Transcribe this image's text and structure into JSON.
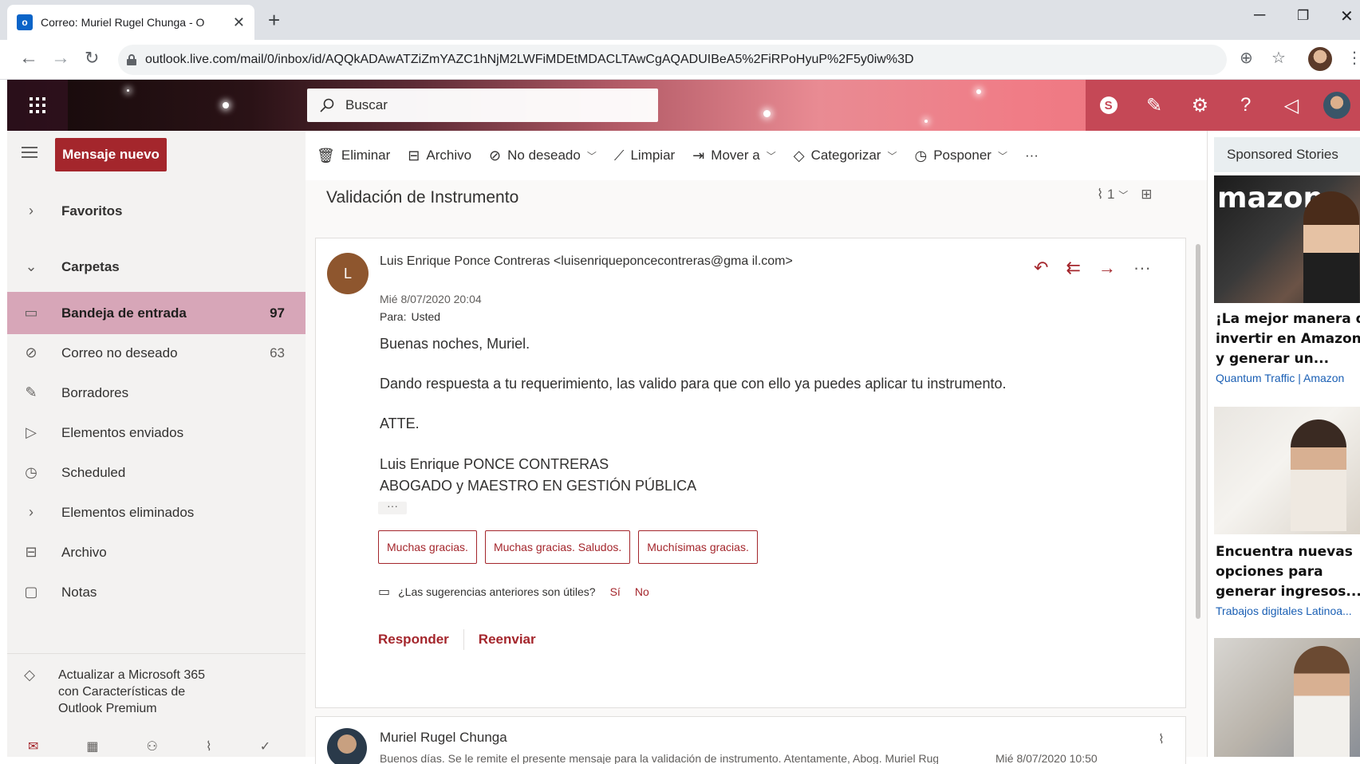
{
  "browser": {
    "tab_title": "Correo: Muriel Rugel Chunga - O",
    "url": "outlook.live.com/mail/0/inbox/id/AQQkADAwATZiZmYAZC1hNjM2LWFiMDEtMDACLTAwCgAQADUIBeA5%2FiRPoHyuP%2F5y0iw%3D"
  },
  "header": {
    "search_placeholder": "Buscar"
  },
  "nav": {
    "new_message": "Mensaje nuevo",
    "favorites": "Favoritos",
    "folders": "Carpetas",
    "items": [
      {
        "label": "Bandeja de entrada",
        "count": "97",
        "icon": "inbox-icon"
      },
      {
        "label": "Correo no deseado",
        "count": "63",
        "icon": "blocked-icon"
      },
      {
        "label": "Borradores",
        "count": "",
        "icon": "pencil-icon"
      },
      {
        "label": "Elementos enviados",
        "count": "",
        "icon": "send-icon"
      },
      {
        "label": "Scheduled",
        "count": "",
        "icon": "clock-icon"
      },
      {
        "label": "Elementos eliminados",
        "count": "",
        "icon": "chevron-right-icon"
      },
      {
        "label": "Archivo",
        "count": "",
        "icon": "archive-icon"
      },
      {
        "label": "Notas",
        "count": "",
        "icon": "note-icon"
      }
    ],
    "upgrade": "Actualizar a Microsoft 365 con Características de Outlook Premium"
  },
  "toolbar": {
    "delete": "Eliminar",
    "archive": "Archivo",
    "junk": "No deseado",
    "sweep": "Limpiar",
    "move": "Mover a",
    "categorize": "Categorizar",
    "snooze": "Posponer"
  },
  "email": {
    "subject": "Validación de Instrumento",
    "attachment_count": "1",
    "sender_initial": "L",
    "from": "Luis Enrique Ponce Contreras <luisenriqueponcecontreras@gma il.com>",
    "date": "Mié 8/07/2020 20:04",
    "to_label": "Para:",
    "to_value": "Usted",
    "greeting": "Buenas noches, Muriel.",
    "body": "Dando respuesta a tu requerimiento, las  valido para que con ello ya puedes aplicar tu instrumento.",
    "closing": "ATTE.",
    "signature_name": "Luis Enrique PONCE CONTRERAS",
    "signature_title": "ABOGADO y MAESTRO EN GESTIÓN PÚBLICA",
    "expander": "···",
    "suggestions": [
      "Muchas gracias.",
      "Muchas gracias. Saludos.",
      "Muchísimas gracias."
    ],
    "feedback_question": "¿Las sugerencias anteriores son útiles?",
    "feedback_yes": "Sí",
    "feedback_no": "No",
    "reply": "Responder",
    "forward": "Reenviar"
  },
  "email2": {
    "sender": "Muriel Rugel Chunga",
    "preview": "Buenos días. Se le remite el presente mensaje para la validación de instrumento. Atentamente, Abog. Muriel Rugel",
    "date": "Mié 8/07/2020 10:50"
  },
  "ads": {
    "header": "Sponsored Stories",
    "items": [
      {
        "brand": "mazon",
        "title_l1": "¡La mejor manera d",
        "title_l2": "invertir en Amazon",
        "title_l3": "y generar un...",
        "source": "Quantum Traffic | Amazon"
      },
      {
        "title_l1": "Encuentra nuevas",
        "title_l2": "opciones para",
        "title_l3": "generar ingresos...",
        "source": "Trabajos digitales Latinoa..."
      }
    ]
  },
  "colors": {
    "accent": "#a4262c",
    "selected_folder": "#d7a6b8",
    "header_right": "#c54856"
  }
}
